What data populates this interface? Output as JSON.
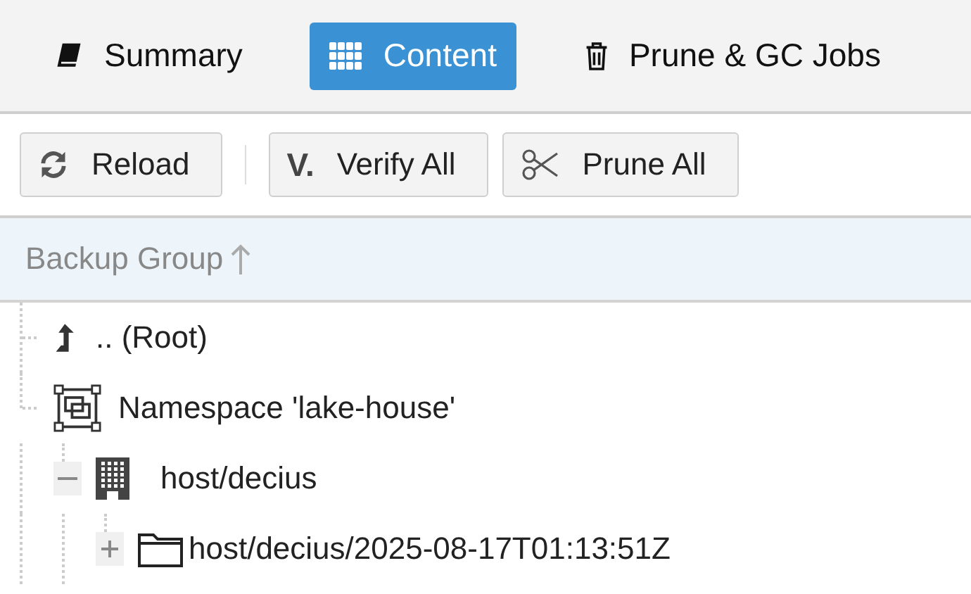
{
  "tabs": [
    {
      "label": "Summary",
      "selected": false
    },
    {
      "label": "Content",
      "selected": true
    },
    {
      "label": "Prune & GC Jobs",
      "selected": false
    }
  ],
  "toolbar": [
    {
      "label": "Reload"
    },
    {
      "label": "Verify All",
      "icon_text": "V."
    },
    {
      "label": "Prune All"
    }
  ],
  "table": {
    "columns": [
      {
        "label": "Backup Group",
        "sorted_ascending": true
      }
    ],
    "tree": [
      {
        "label": ".. (Root)",
        "kind": "parent"
      },
      {
        "label": "Namespace 'lake-house'",
        "kind": "namespace",
        "children": [
          {
            "label": "host/decius",
            "kind": "group",
            "expanded": true,
            "children": [
              {
                "label": "host/decius/2025-08-17T01:13:51Z",
                "kind": "snapshot",
                "expanded": false
              }
            ]
          }
        ]
      }
    ]
  }
}
